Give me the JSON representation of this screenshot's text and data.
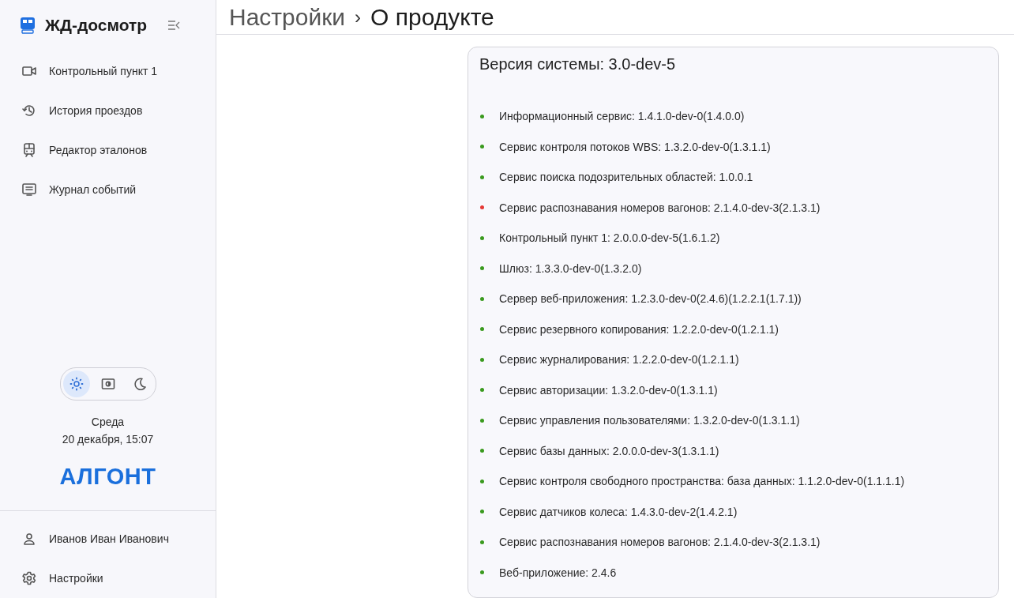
{
  "sidebar": {
    "app_title": "ЖД-досмотр",
    "nav_items": [
      {
        "label": "Контрольный пункт 1"
      },
      {
        "label": "История проездов"
      },
      {
        "label": "Редактор эталонов"
      },
      {
        "label": "Журнал событий"
      }
    ],
    "theme_options": [
      {
        "kind": "light",
        "selected": true
      },
      {
        "kind": "contrast",
        "selected": false
      },
      {
        "kind": "dark",
        "selected": false
      }
    ],
    "day": "Среда",
    "date_time": "20 декабря, 15:07",
    "logo": "АЛГОНТ",
    "bottom_items": [
      {
        "label": "Иванов Иван Иванович"
      },
      {
        "label": "Настройки"
      }
    ]
  },
  "breadcrumb": {
    "parent": "Настройки",
    "separator": "›",
    "current": "О продукте"
  },
  "version_card": {
    "title": "Версия системы: 3.0-dev-5",
    "services": [
      {
        "text": "Информационный сервис: 1.4.1.0-dev-0(1.4.0.0)",
        "color": "#3a9a1e"
      },
      {
        "text": "Сервис контроля потоков WBS: 1.3.2.0-dev-0(1.3.1.1)",
        "color": "#3a9a1e"
      },
      {
        "text": "Сервис поиска подозрительных областей: 1.0.0.1",
        "color": "#3a9a1e"
      },
      {
        "text": "Сервис распознавания номеров вагонов: 2.1.4.0-dev-3(2.1.3.1)",
        "color": "#e53935"
      },
      {
        "text": "Контрольный пункт 1: 2.0.0.0-dev-5(1.6.1.2)",
        "color": "#3a9a1e"
      },
      {
        "text": "Шлюз: 1.3.3.0-dev-0(1.3.2.0)",
        "color": "#3a9a1e"
      },
      {
        "text": "Сервер веб-приложения: 1.2.3.0-dev-0(2.4.6)(1.2.2.1(1.7.1))",
        "color": "#3a9a1e"
      },
      {
        "text": "Сервис резервного копирования: 1.2.2.0-dev-0(1.2.1.1)",
        "color": "#3a9a1e"
      },
      {
        "text": "Сервис журналирования: 1.2.2.0-dev-0(1.2.1.1)",
        "color": "#3a9a1e"
      },
      {
        "text": "Сервис авторизации: 1.3.2.0-dev-0(1.3.1.1)",
        "color": "#3a9a1e"
      },
      {
        "text": "Сервис управления пользователями: 1.3.2.0-dev-0(1.3.1.1)",
        "color": "#3a9a1e"
      },
      {
        "text": "Сервис базы данных: 2.0.0.0-dev-3(1.3.1.1)",
        "color": "#3a9a1e"
      },
      {
        "text": "Сервис контроля свободного пространства: база данных: 1.1.2.0-dev-0(1.1.1.1)",
        "color": "#3a9a1e"
      },
      {
        "text": "Сервис датчиков колеса: 1.4.3.0-dev-2(1.4.2.1)",
        "color": "#3a9a1e"
      },
      {
        "text": "Сервис распознавания номеров вагонов: 2.1.4.0-dev-3(2.1.3.1)",
        "color": "#3a9a1e"
      },
      {
        "text": "Веб-приложение: 2.4.6",
        "color": "#3a9a1e"
      }
    ]
  }
}
